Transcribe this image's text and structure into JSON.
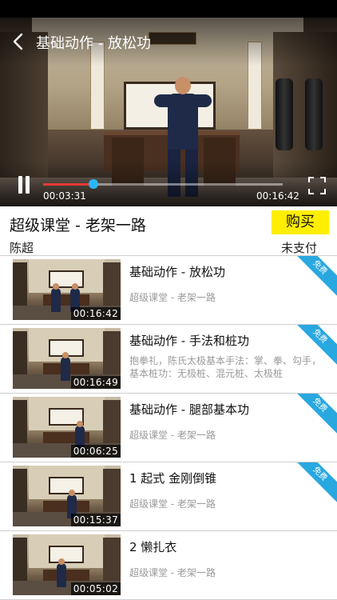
{
  "player": {
    "title": "基础动作 - 放松功",
    "time_current": "00:03:31",
    "time_total": "00:16:42",
    "progress_fraction": 0.21,
    "colors": {
      "progress": "#e53935",
      "knob": "#29b6f6"
    },
    "icons": {
      "back": "chevron-left-icon",
      "pause": "pause-icon",
      "fullscreen": "fullscreen-icon"
    }
  },
  "course": {
    "title": "超级课堂 - 老架一路",
    "author": "陈超",
    "buy_label": "购买",
    "pay_status": "未支付",
    "colors": {
      "buy_bg": "#ffee00",
      "ribbon": "#29a8e0"
    }
  },
  "lessons": [
    {
      "title": "基础动作 - 放松功",
      "subtitle": "超级课堂 - 老架一路",
      "description": "",
      "duration": "00:16:42",
      "badge": "免费"
    },
    {
      "title": "基础动作 - 手法和桩功",
      "subtitle": "",
      "description": "抱拳礼，陈氏太极基本手法：掌、拳、勾手，基本桩功：无极桩、混元桩、太极桩",
      "duration": "00:16:49",
      "badge": "免费"
    },
    {
      "title": "基础动作 - 腿部基本功",
      "subtitle": "超级课堂 - 老架一路",
      "description": "",
      "duration": "00:06:25",
      "badge": "免费"
    },
    {
      "title": "1 起式 金刚倒锥",
      "subtitle": "超级课堂 - 老架一路",
      "description": "",
      "duration": "00:15:37",
      "badge": "免费"
    },
    {
      "title": "2 懒扎衣",
      "subtitle": "超级课堂 - 老架一路",
      "description": "",
      "duration": "00:05:02",
      "badge": ""
    }
  ]
}
